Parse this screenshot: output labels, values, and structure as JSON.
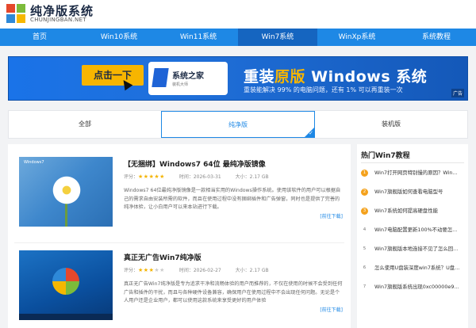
{
  "header": {
    "logo_name": "纯净版系统",
    "logo_sub": "CHUNJINGBAN.NET"
  },
  "nav": [
    {
      "label": "首页"
    },
    {
      "label": "Win10系统"
    },
    {
      "label": "Win11系统"
    },
    {
      "label": "Win7系统"
    },
    {
      "label": "WinXp系统"
    },
    {
      "label": "系统教程"
    }
  ],
  "banner": {
    "cta": "点击一下",
    "brand": "系统之家",
    "brand_sub": "装机大师",
    "title_pre": "重装",
    "title_hl": "原版",
    "title_post": " Windows 系统",
    "sub_pre": "重装能解决 99% 的电脑问题，还有 1% 可以再重装一次",
    "ad": "广告"
  },
  "tabs": [
    {
      "label": "全部"
    },
    {
      "label": "纯净版"
    },
    {
      "label": "装机版"
    }
  ],
  "articles": [
    {
      "thumb_text": "Windows7",
      "title": "【无捆绑】Windows7 64位 最纯净版镜像",
      "rating_label": "评分：",
      "stars_on": "★★★★★",
      "stars_off": "",
      "time_label": "时间：2026-03-31",
      "size_label": "大小：2.17 GB",
      "desc": "Windows7 64位最纯净版镜像是一款相当实用的Windows操作系统。使用该软件的用户可以根据自己的需求自由安装所需的软件，而且在使用过程中没有捆绑插件和广告弹窗，同时也是提供了完善的纯净体验，让小白用户可以来本站进行下载。",
      "more": "[前往下载]"
    },
    {
      "thumb_text": "",
      "title": "真正无广告Win7纯净版",
      "rating_label": "评分：",
      "stars_on": "★★★",
      "stars_off": "★★",
      "time_label": "时间：2026-02-27",
      "size_label": "大小：2.17 GB",
      "desc": "真正无广告Win7纯净版是专为追求干净和流畅体验的用户而推荐的，不仅在使用的时候不会受到任何广告和插件的干扰，而且与各种硬件设备兼容，确保用户在使用过程中不会出现任何问题。无论是个人用户还是企业用户，都可以使用这款系统来享受更好的用户体验",
      "more": "[前往下载]"
    }
  ],
  "sidebar": {
    "title": "热门Win7教程",
    "items": [
      {
        "num": "1",
        "text": "Win7打开网页特别慢的原因？Win..."
      },
      {
        "num": "2",
        "text": "Win7旗舰版如何查看电脑型号"
      },
      {
        "num": "3",
        "text": "Win7系统如何提高硬盘性能"
      },
      {
        "num": "4",
        "text": "Win7电脑配置更新100%不动要怎..."
      },
      {
        "num": "5",
        "text": "Win7旗舰版本地连接不见了怎么回..."
      },
      {
        "num": "6",
        "text": "怎么使用U盘装深度win7系统？U盘..."
      },
      {
        "num": "7",
        "text": "Win7旗舰版系统出现0xc00000e9..."
      }
    ]
  },
  "colors": {
    "nav": "#1e88e5",
    "nav_active": "#1565c0",
    "accent": "#f7b500"
  }
}
